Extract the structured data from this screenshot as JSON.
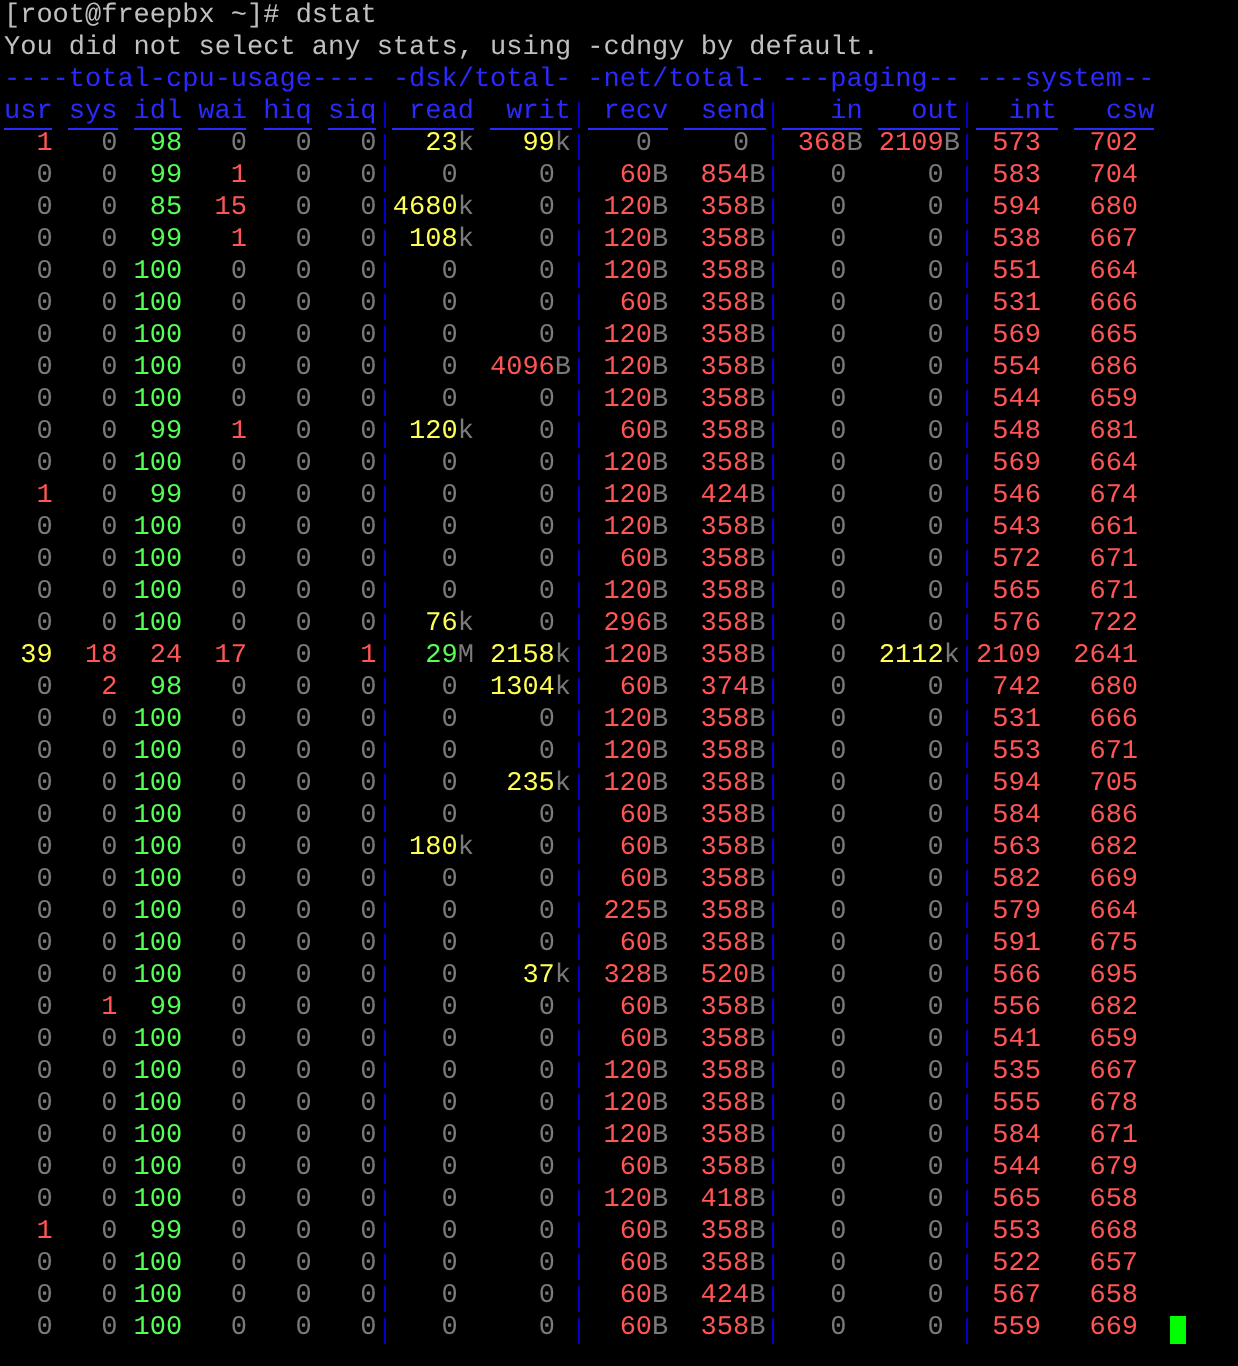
{
  "prompt": "[root@freepbx ~]# dstat",
  "message": "You did not select any stats, using -cdngy by default.",
  "groups": [
    {
      "title": "----total-cpu-usage----",
      "kind": "percent",
      "columns": [
        "usr",
        "sys",
        "idl",
        "wai",
        "hiq",
        "siq"
      ]
    },
    {
      "title": "-dsk/total-",
      "kind": "value",
      "columns": [
        "read",
        "writ"
      ]
    },
    {
      "title": "-net/total-",
      "kind": "value",
      "columns": [
        "recv",
        "send"
      ]
    },
    {
      "title": "---paging--",
      "kind": "value",
      "columns": [
        "in",
        "out"
      ]
    },
    {
      "title": "---system--",
      "kind": "value",
      "columns": [
        "int",
        "csw"
      ]
    }
  ],
  "cursor_visible": true,
  "rows": [
    {
      "cells": [
        {
          "text": "1",
          "color": "#ff5555"
        },
        {
          "text": "0"
        },
        {
          "text": "98",
          "color": "#55ff55"
        },
        {
          "text": "0"
        },
        {
          "text": "0"
        },
        {
          "text": "0"
        },
        {
          "text": "23",
          "unit": "k",
          "color": "#ffff55"
        },
        {
          "text": "99",
          "unit": "k",
          "color": "#ffff55"
        },
        {
          "text": "0"
        },
        {
          "text": "0"
        },
        {
          "text": "368",
          "unit": "B",
          "color": "#ff5555"
        },
        {
          "text": "2109",
          "unit": "B",
          "color": "#ff5555"
        },
        {
          "text": "573",
          "color": "#ff5555"
        },
        {
          "text": "702",
          "color": "#ff5555"
        }
      ]
    },
    {
      "cells": [
        {
          "text": "0"
        },
        {
          "text": "0"
        },
        {
          "text": "99",
          "color": "#55ff55"
        },
        {
          "text": "1",
          "color": "#ff5555"
        },
        {
          "text": "0"
        },
        {
          "text": "0"
        },
        {
          "text": "0"
        },
        {
          "text": "0"
        },
        {
          "text": "60",
          "unit": "B",
          "color": "#ff5555"
        },
        {
          "text": "854",
          "unit": "B",
          "color": "#ff5555"
        },
        {
          "text": "0"
        },
        {
          "text": "0"
        },
        {
          "text": "583",
          "color": "#ff5555"
        },
        {
          "text": "704",
          "color": "#ff5555"
        }
      ]
    },
    {
      "cells": [
        {
          "text": "0"
        },
        {
          "text": "0"
        },
        {
          "text": "85",
          "color": "#55ff55"
        },
        {
          "text": "15",
          "color": "#ff5555"
        },
        {
          "text": "0"
        },
        {
          "text": "0"
        },
        {
          "text": "4680",
          "unit": "k",
          "color": "#ffff55"
        },
        {
          "text": "0"
        },
        {
          "text": "120",
          "unit": "B",
          "color": "#ff5555"
        },
        {
          "text": "358",
          "unit": "B",
          "color": "#ff5555"
        },
        {
          "text": "0"
        },
        {
          "text": "0"
        },
        {
          "text": "594",
          "color": "#ff5555"
        },
        {
          "text": "680",
          "color": "#ff5555"
        }
      ]
    },
    {
      "cells": [
        {
          "text": "0"
        },
        {
          "text": "0"
        },
        {
          "text": "99",
          "color": "#55ff55"
        },
        {
          "text": "1",
          "color": "#ff5555"
        },
        {
          "text": "0"
        },
        {
          "text": "0"
        },
        {
          "text": "108",
          "unit": "k",
          "color": "#ffff55"
        },
        {
          "text": "0"
        },
        {
          "text": "120",
          "unit": "B",
          "color": "#ff5555"
        },
        {
          "text": "358",
          "unit": "B",
          "color": "#ff5555"
        },
        {
          "text": "0"
        },
        {
          "text": "0"
        },
        {
          "text": "538",
          "color": "#ff5555"
        },
        {
          "text": "667",
          "color": "#ff5555"
        }
      ]
    },
    {
      "cells": [
        {
          "text": "0"
        },
        {
          "text": "0"
        },
        {
          "text": "100",
          "color": "#55ff55"
        },
        {
          "text": "0"
        },
        {
          "text": "0"
        },
        {
          "text": "0"
        },
        {
          "text": "0"
        },
        {
          "text": "0"
        },
        {
          "text": "120",
          "unit": "B",
          "color": "#ff5555"
        },
        {
          "text": "358",
          "unit": "B",
          "color": "#ff5555"
        },
        {
          "text": "0"
        },
        {
          "text": "0"
        },
        {
          "text": "551",
          "color": "#ff5555"
        },
        {
          "text": "664",
          "color": "#ff5555"
        }
      ]
    },
    {
      "cells": [
        {
          "text": "0"
        },
        {
          "text": "0"
        },
        {
          "text": "100",
          "color": "#55ff55"
        },
        {
          "text": "0"
        },
        {
          "text": "0"
        },
        {
          "text": "0"
        },
        {
          "text": "0"
        },
        {
          "text": "0"
        },
        {
          "text": "60",
          "unit": "B",
          "color": "#ff5555"
        },
        {
          "text": "358",
          "unit": "B",
          "color": "#ff5555"
        },
        {
          "text": "0"
        },
        {
          "text": "0"
        },
        {
          "text": "531",
          "color": "#ff5555"
        },
        {
          "text": "666",
          "color": "#ff5555"
        }
      ]
    },
    {
      "cells": [
        {
          "text": "0"
        },
        {
          "text": "0"
        },
        {
          "text": "100",
          "color": "#55ff55"
        },
        {
          "text": "0"
        },
        {
          "text": "0"
        },
        {
          "text": "0"
        },
        {
          "text": "0"
        },
        {
          "text": "0"
        },
        {
          "text": "120",
          "unit": "B",
          "color": "#ff5555"
        },
        {
          "text": "358",
          "unit": "B",
          "color": "#ff5555"
        },
        {
          "text": "0"
        },
        {
          "text": "0"
        },
        {
          "text": "569",
          "color": "#ff5555"
        },
        {
          "text": "665",
          "color": "#ff5555"
        }
      ]
    },
    {
      "cells": [
        {
          "text": "0"
        },
        {
          "text": "0"
        },
        {
          "text": "100",
          "color": "#55ff55"
        },
        {
          "text": "0"
        },
        {
          "text": "0"
        },
        {
          "text": "0"
        },
        {
          "text": "0"
        },
        {
          "text": "4096",
          "unit": "B",
          "color": "#ff5555"
        },
        {
          "text": "120",
          "unit": "B",
          "color": "#ff5555"
        },
        {
          "text": "358",
          "unit": "B",
          "color": "#ff5555"
        },
        {
          "text": "0"
        },
        {
          "text": "0"
        },
        {
          "text": "554",
          "color": "#ff5555"
        },
        {
          "text": "686",
          "color": "#ff5555"
        }
      ]
    },
    {
      "cells": [
        {
          "text": "0"
        },
        {
          "text": "0"
        },
        {
          "text": "100",
          "color": "#55ff55"
        },
        {
          "text": "0"
        },
        {
          "text": "0"
        },
        {
          "text": "0"
        },
        {
          "text": "0"
        },
        {
          "text": "0"
        },
        {
          "text": "120",
          "unit": "B",
          "color": "#ff5555"
        },
        {
          "text": "358",
          "unit": "B",
          "color": "#ff5555"
        },
        {
          "text": "0"
        },
        {
          "text": "0"
        },
        {
          "text": "544",
          "color": "#ff5555"
        },
        {
          "text": "659",
          "color": "#ff5555"
        }
      ]
    },
    {
      "cells": [
        {
          "text": "0"
        },
        {
          "text": "0"
        },
        {
          "text": "99",
          "color": "#55ff55"
        },
        {
          "text": "1",
          "color": "#ff5555"
        },
        {
          "text": "0"
        },
        {
          "text": "0"
        },
        {
          "text": "120",
          "unit": "k",
          "color": "#ffff55"
        },
        {
          "text": "0"
        },
        {
          "text": "60",
          "unit": "B",
          "color": "#ff5555"
        },
        {
          "text": "358",
          "unit": "B",
          "color": "#ff5555"
        },
        {
          "text": "0"
        },
        {
          "text": "0"
        },
        {
          "text": "548",
          "color": "#ff5555"
        },
        {
          "text": "681",
          "color": "#ff5555"
        }
      ]
    },
    {
      "cells": [
        {
          "text": "0"
        },
        {
          "text": "0"
        },
        {
          "text": "100",
          "color": "#55ff55"
        },
        {
          "text": "0"
        },
        {
          "text": "0"
        },
        {
          "text": "0"
        },
        {
          "text": "0"
        },
        {
          "text": "0"
        },
        {
          "text": "120",
          "unit": "B",
          "color": "#ff5555"
        },
        {
          "text": "358",
          "unit": "B",
          "color": "#ff5555"
        },
        {
          "text": "0"
        },
        {
          "text": "0"
        },
        {
          "text": "569",
          "color": "#ff5555"
        },
        {
          "text": "664",
          "color": "#ff5555"
        }
      ]
    },
    {
      "cells": [
        {
          "text": "1",
          "color": "#ff5555"
        },
        {
          "text": "0"
        },
        {
          "text": "99",
          "color": "#55ff55"
        },
        {
          "text": "0"
        },
        {
          "text": "0"
        },
        {
          "text": "0"
        },
        {
          "text": "0"
        },
        {
          "text": "0"
        },
        {
          "text": "120",
          "unit": "B",
          "color": "#ff5555"
        },
        {
          "text": "424",
          "unit": "B",
          "color": "#ff5555"
        },
        {
          "text": "0"
        },
        {
          "text": "0"
        },
        {
          "text": "546",
          "color": "#ff5555"
        },
        {
          "text": "674",
          "color": "#ff5555"
        }
      ]
    },
    {
      "cells": [
        {
          "text": "0"
        },
        {
          "text": "0"
        },
        {
          "text": "100",
          "color": "#55ff55"
        },
        {
          "text": "0"
        },
        {
          "text": "0"
        },
        {
          "text": "0"
        },
        {
          "text": "0"
        },
        {
          "text": "0"
        },
        {
          "text": "120",
          "unit": "B",
          "color": "#ff5555"
        },
        {
          "text": "358",
          "unit": "B",
          "color": "#ff5555"
        },
        {
          "text": "0"
        },
        {
          "text": "0"
        },
        {
          "text": "543",
          "color": "#ff5555"
        },
        {
          "text": "661",
          "color": "#ff5555"
        }
      ]
    },
    {
      "cells": [
        {
          "text": "0"
        },
        {
          "text": "0"
        },
        {
          "text": "100",
          "color": "#55ff55"
        },
        {
          "text": "0"
        },
        {
          "text": "0"
        },
        {
          "text": "0"
        },
        {
          "text": "0"
        },
        {
          "text": "0"
        },
        {
          "text": "60",
          "unit": "B",
          "color": "#ff5555"
        },
        {
          "text": "358",
          "unit": "B",
          "color": "#ff5555"
        },
        {
          "text": "0"
        },
        {
          "text": "0"
        },
        {
          "text": "572",
          "color": "#ff5555"
        },
        {
          "text": "671",
          "color": "#ff5555"
        }
      ]
    },
    {
      "cells": [
        {
          "text": "0"
        },
        {
          "text": "0"
        },
        {
          "text": "100",
          "color": "#55ff55"
        },
        {
          "text": "0"
        },
        {
          "text": "0"
        },
        {
          "text": "0"
        },
        {
          "text": "0"
        },
        {
          "text": "0"
        },
        {
          "text": "120",
          "unit": "B",
          "color": "#ff5555"
        },
        {
          "text": "358",
          "unit": "B",
          "color": "#ff5555"
        },
        {
          "text": "0"
        },
        {
          "text": "0"
        },
        {
          "text": "565",
          "color": "#ff5555"
        },
        {
          "text": "671",
          "color": "#ff5555"
        }
      ]
    },
    {
      "cells": [
        {
          "text": "0"
        },
        {
          "text": "0"
        },
        {
          "text": "100",
          "color": "#55ff55"
        },
        {
          "text": "0"
        },
        {
          "text": "0"
        },
        {
          "text": "0"
        },
        {
          "text": "76",
          "unit": "k",
          "color": "#ffff55"
        },
        {
          "text": "0"
        },
        {
          "text": "296",
          "unit": "B",
          "color": "#ff5555"
        },
        {
          "text": "358",
          "unit": "B",
          "color": "#ff5555"
        },
        {
          "text": "0"
        },
        {
          "text": "0"
        },
        {
          "text": "576",
          "color": "#ff5555"
        },
        {
          "text": "722",
          "color": "#ff5555"
        }
      ]
    },
    {
      "cells": [
        {
          "text": "39",
          "color": "#ffff55"
        },
        {
          "text": "18",
          "color": "#ff5555"
        },
        {
          "text": "24",
          "color": "#ff5555"
        },
        {
          "text": "17",
          "color": "#ff5555"
        },
        {
          "text": "0"
        },
        {
          "text": "1",
          "color": "#ff5555"
        },
        {
          "text": "29",
          "unit": "M",
          "color": "#55ff55"
        },
        {
          "text": "2158",
          "unit": "k",
          "color": "#ffff55"
        },
        {
          "text": "120",
          "unit": "B",
          "color": "#ff5555"
        },
        {
          "text": "358",
          "unit": "B",
          "color": "#ff5555"
        },
        {
          "text": "0"
        },
        {
          "text": "2112",
          "unit": "k",
          "color": "#ffff55"
        },
        {
          "text": "2109",
          "color": "#ff5555"
        },
        {
          "text": "2641",
          "color": "#ff5555"
        }
      ]
    },
    {
      "cells": [
        {
          "text": "0"
        },
        {
          "text": "2",
          "color": "#ff5555"
        },
        {
          "text": "98",
          "color": "#55ff55"
        },
        {
          "text": "0"
        },
        {
          "text": "0"
        },
        {
          "text": "0"
        },
        {
          "text": "0"
        },
        {
          "text": "1304",
          "unit": "k",
          "color": "#ffff55"
        },
        {
          "text": "60",
          "unit": "B",
          "color": "#ff5555"
        },
        {
          "text": "374",
          "unit": "B",
          "color": "#ff5555"
        },
        {
          "text": "0"
        },
        {
          "text": "0"
        },
        {
          "text": "742",
          "color": "#ff5555"
        },
        {
          "text": "680",
          "color": "#ff5555"
        }
      ]
    },
    {
      "cells": [
        {
          "text": "0"
        },
        {
          "text": "0"
        },
        {
          "text": "100",
          "color": "#55ff55"
        },
        {
          "text": "0"
        },
        {
          "text": "0"
        },
        {
          "text": "0"
        },
        {
          "text": "0"
        },
        {
          "text": "0"
        },
        {
          "text": "120",
          "unit": "B",
          "color": "#ff5555"
        },
        {
          "text": "358",
          "unit": "B",
          "color": "#ff5555"
        },
        {
          "text": "0"
        },
        {
          "text": "0"
        },
        {
          "text": "531",
          "color": "#ff5555"
        },
        {
          "text": "666",
          "color": "#ff5555"
        }
      ]
    },
    {
      "cells": [
        {
          "text": "0"
        },
        {
          "text": "0"
        },
        {
          "text": "100",
          "color": "#55ff55"
        },
        {
          "text": "0"
        },
        {
          "text": "0"
        },
        {
          "text": "0"
        },
        {
          "text": "0"
        },
        {
          "text": "0"
        },
        {
          "text": "120",
          "unit": "B",
          "color": "#ff5555"
        },
        {
          "text": "358",
          "unit": "B",
          "color": "#ff5555"
        },
        {
          "text": "0"
        },
        {
          "text": "0"
        },
        {
          "text": "553",
          "color": "#ff5555"
        },
        {
          "text": "671",
          "color": "#ff5555"
        }
      ]
    },
    {
      "cells": [
        {
          "text": "0"
        },
        {
          "text": "0"
        },
        {
          "text": "100",
          "color": "#55ff55"
        },
        {
          "text": "0"
        },
        {
          "text": "0"
        },
        {
          "text": "0"
        },
        {
          "text": "0"
        },
        {
          "text": "235",
          "unit": "k",
          "color": "#ffff55"
        },
        {
          "text": "120",
          "unit": "B",
          "color": "#ff5555"
        },
        {
          "text": "358",
          "unit": "B",
          "color": "#ff5555"
        },
        {
          "text": "0"
        },
        {
          "text": "0"
        },
        {
          "text": "594",
          "color": "#ff5555"
        },
        {
          "text": "705",
          "color": "#ff5555"
        }
      ]
    },
    {
      "cells": [
        {
          "text": "0"
        },
        {
          "text": "0"
        },
        {
          "text": "100",
          "color": "#55ff55"
        },
        {
          "text": "0"
        },
        {
          "text": "0"
        },
        {
          "text": "0"
        },
        {
          "text": "0"
        },
        {
          "text": "0"
        },
        {
          "text": "60",
          "unit": "B",
          "color": "#ff5555"
        },
        {
          "text": "358",
          "unit": "B",
          "color": "#ff5555"
        },
        {
          "text": "0"
        },
        {
          "text": "0"
        },
        {
          "text": "584",
          "color": "#ff5555"
        },
        {
          "text": "686",
          "color": "#ff5555"
        }
      ]
    },
    {
      "cells": [
        {
          "text": "0"
        },
        {
          "text": "0"
        },
        {
          "text": "100",
          "color": "#55ff55"
        },
        {
          "text": "0"
        },
        {
          "text": "0"
        },
        {
          "text": "0"
        },
        {
          "text": "180",
          "unit": "k",
          "color": "#ffff55"
        },
        {
          "text": "0"
        },
        {
          "text": "60",
          "unit": "B",
          "color": "#ff5555"
        },
        {
          "text": "358",
          "unit": "B",
          "color": "#ff5555"
        },
        {
          "text": "0"
        },
        {
          "text": "0"
        },
        {
          "text": "563",
          "color": "#ff5555"
        },
        {
          "text": "682",
          "color": "#ff5555"
        }
      ]
    },
    {
      "cells": [
        {
          "text": "0"
        },
        {
          "text": "0"
        },
        {
          "text": "100",
          "color": "#55ff55"
        },
        {
          "text": "0"
        },
        {
          "text": "0"
        },
        {
          "text": "0"
        },
        {
          "text": "0"
        },
        {
          "text": "0"
        },
        {
          "text": "60",
          "unit": "B",
          "color": "#ff5555"
        },
        {
          "text": "358",
          "unit": "B",
          "color": "#ff5555"
        },
        {
          "text": "0"
        },
        {
          "text": "0"
        },
        {
          "text": "582",
          "color": "#ff5555"
        },
        {
          "text": "669",
          "color": "#ff5555"
        }
      ]
    },
    {
      "cells": [
        {
          "text": "0"
        },
        {
          "text": "0"
        },
        {
          "text": "100",
          "color": "#55ff55"
        },
        {
          "text": "0"
        },
        {
          "text": "0"
        },
        {
          "text": "0"
        },
        {
          "text": "0"
        },
        {
          "text": "0"
        },
        {
          "text": "225",
          "unit": "B",
          "color": "#ff5555"
        },
        {
          "text": "358",
          "unit": "B",
          "color": "#ff5555"
        },
        {
          "text": "0"
        },
        {
          "text": "0"
        },
        {
          "text": "579",
          "color": "#ff5555"
        },
        {
          "text": "664",
          "color": "#ff5555"
        }
      ]
    },
    {
      "cells": [
        {
          "text": "0"
        },
        {
          "text": "0"
        },
        {
          "text": "100",
          "color": "#55ff55"
        },
        {
          "text": "0"
        },
        {
          "text": "0"
        },
        {
          "text": "0"
        },
        {
          "text": "0"
        },
        {
          "text": "0"
        },
        {
          "text": "60",
          "unit": "B",
          "color": "#ff5555"
        },
        {
          "text": "358",
          "unit": "B",
          "color": "#ff5555"
        },
        {
          "text": "0"
        },
        {
          "text": "0"
        },
        {
          "text": "591",
          "color": "#ff5555"
        },
        {
          "text": "675",
          "color": "#ff5555"
        }
      ]
    },
    {
      "cells": [
        {
          "text": "0"
        },
        {
          "text": "0"
        },
        {
          "text": "100",
          "color": "#55ff55"
        },
        {
          "text": "0"
        },
        {
          "text": "0"
        },
        {
          "text": "0"
        },
        {
          "text": "0"
        },
        {
          "text": "37",
          "unit": "k",
          "color": "#ffff55"
        },
        {
          "text": "328",
          "unit": "B",
          "color": "#ff5555"
        },
        {
          "text": "520",
          "unit": "B",
          "color": "#ff5555"
        },
        {
          "text": "0"
        },
        {
          "text": "0"
        },
        {
          "text": "566",
          "color": "#ff5555"
        },
        {
          "text": "695",
          "color": "#ff5555"
        }
      ]
    },
    {
      "cells": [
        {
          "text": "0"
        },
        {
          "text": "1",
          "color": "#ff5555"
        },
        {
          "text": "99",
          "color": "#55ff55"
        },
        {
          "text": "0"
        },
        {
          "text": "0"
        },
        {
          "text": "0"
        },
        {
          "text": "0"
        },
        {
          "text": "0"
        },
        {
          "text": "60",
          "unit": "B",
          "color": "#ff5555"
        },
        {
          "text": "358",
          "unit": "B",
          "color": "#ff5555"
        },
        {
          "text": "0"
        },
        {
          "text": "0"
        },
        {
          "text": "556",
          "color": "#ff5555"
        },
        {
          "text": "682",
          "color": "#ff5555"
        }
      ]
    },
    {
      "cells": [
        {
          "text": "0"
        },
        {
          "text": "0"
        },
        {
          "text": "100",
          "color": "#55ff55"
        },
        {
          "text": "0"
        },
        {
          "text": "0"
        },
        {
          "text": "0"
        },
        {
          "text": "0"
        },
        {
          "text": "0"
        },
        {
          "text": "60",
          "unit": "B",
          "color": "#ff5555"
        },
        {
          "text": "358",
          "unit": "B",
          "color": "#ff5555"
        },
        {
          "text": "0"
        },
        {
          "text": "0"
        },
        {
          "text": "541",
          "color": "#ff5555"
        },
        {
          "text": "659",
          "color": "#ff5555"
        }
      ]
    },
    {
      "cells": [
        {
          "text": "0"
        },
        {
          "text": "0"
        },
        {
          "text": "100",
          "color": "#55ff55"
        },
        {
          "text": "0"
        },
        {
          "text": "0"
        },
        {
          "text": "0"
        },
        {
          "text": "0"
        },
        {
          "text": "0"
        },
        {
          "text": "120",
          "unit": "B",
          "color": "#ff5555"
        },
        {
          "text": "358",
          "unit": "B",
          "color": "#ff5555"
        },
        {
          "text": "0"
        },
        {
          "text": "0"
        },
        {
          "text": "535",
          "color": "#ff5555"
        },
        {
          "text": "667",
          "color": "#ff5555"
        }
      ]
    },
    {
      "cells": [
        {
          "text": "0"
        },
        {
          "text": "0"
        },
        {
          "text": "100",
          "color": "#55ff55"
        },
        {
          "text": "0"
        },
        {
          "text": "0"
        },
        {
          "text": "0"
        },
        {
          "text": "0"
        },
        {
          "text": "0"
        },
        {
          "text": "120",
          "unit": "B",
          "color": "#ff5555"
        },
        {
          "text": "358",
          "unit": "B",
          "color": "#ff5555"
        },
        {
          "text": "0"
        },
        {
          "text": "0"
        },
        {
          "text": "555",
          "color": "#ff5555"
        },
        {
          "text": "678",
          "color": "#ff5555"
        }
      ]
    },
    {
      "cells": [
        {
          "text": "0"
        },
        {
          "text": "0"
        },
        {
          "text": "100",
          "color": "#55ff55"
        },
        {
          "text": "0"
        },
        {
          "text": "0"
        },
        {
          "text": "0"
        },
        {
          "text": "0"
        },
        {
          "text": "0"
        },
        {
          "text": "120",
          "unit": "B",
          "color": "#ff5555"
        },
        {
          "text": "358",
          "unit": "B",
          "color": "#ff5555"
        },
        {
          "text": "0"
        },
        {
          "text": "0"
        },
        {
          "text": "584",
          "color": "#ff5555"
        },
        {
          "text": "671",
          "color": "#ff5555"
        }
      ]
    },
    {
      "cells": [
        {
          "text": "0"
        },
        {
          "text": "0"
        },
        {
          "text": "100",
          "color": "#55ff55"
        },
        {
          "text": "0"
        },
        {
          "text": "0"
        },
        {
          "text": "0"
        },
        {
          "text": "0"
        },
        {
          "text": "0"
        },
        {
          "text": "60",
          "unit": "B",
          "color": "#ff5555"
        },
        {
          "text": "358",
          "unit": "B",
          "color": "#ff5555"
        },
        {
          "text": "0"
        },
        {
          "text": "0"
        },
        {
          "text": "544",
          "color": "#ff5555"
        },
        {
          "text": "679",
          "color": "#ff5555"
        }
      ]
    },
    {
      "cells": [
        {
          "text": "0"
        },
        {
          "text": "0"
        },
        {
          "text": "100",
          "color": "#55ff55"
        },
        {
          "text": "0"
        },
        {
          "text": "0"
        },
        {
          "text": "0"
        },
        {
          "text": "0"
        },
        {
          "text": "0"
        },
        {
          "text": "120",
          "unit": "B",
          "color": "#ff5555"
        },
        {
          "text": "418",
          "unit": "B",
          "color": "#ff5555"
        },
        {
          "text": "0"
        },
        {
          "text": "0"
        },
        {
          "text": "565",
          "color": "#ff5555"
        },
        {
          "text": "658",
          "color": "#ff5555"
        }
      ]
    },
    {
      "cells": [
        {
          "text": "1",
          "color": "#ff5555"
        },
        {
          "text": "0"
        },
        {
          "text": "99",
          "color": "#55ff55"
        },
        {
          "text": "0"
        },
        {
          "text": "0"
        },
        {
          "text": "0"
        },
        {
          "text": "0"
        },
        {
          "text": "0"
        },
        {
          "text": "60",
          "unit": "B",
          "color": "#ff5555"
        },
        {
          "text": "358",
          "unit": "B",
          "color": "#ff5555"
        },
        {
          "text": "0"
        },
        {
          "text": "0"
        },
        {
          "text": "553",
          "color": "#ff5555"
        },
        {
          "text": "668",
          "color": "#ff5555"
        }
      ]
    },
    {
      "cells": [
        {
          "text": "0"
        },
        {
          "text": "0"
        },
        {
          "text": "100",
          "color": "#55ff55"
        },
        {
          "text": "0"
        },
        {
          "text": "0"
        },
        {
          "text": "0"
        },
        {
          "text": "0"
        },
        {
          "text": "0"
        },
        {
          "text": "60",
          "unit": "B",
          "color": "#ff5555"
        },
        {
          "text": "358",
          "unit": "B",
          "color": "#ff5555"
        },
        {
          "text": "0"
        },
        {
          "text": "0"
        },
        {
          "text": "522",
          "color": "#ff5555"
        },
        {
          "text": "657",
          "color": "#ff5555"
        }
      ]
    },
    {
      "cells": [
        {
          "text": "0"
        },
        {
          "text": "0"
        },
        {
          "text": "100",
          "color": "#55ff55"
        },
        {
          "text": "0"
        },
        {
          "text": "0"
        },
        {
          "text": "0"
        },
        {
          "text": "0"
        },
        {
          "text": "0"
        },
        {
          "text": "60",
          "unit": "B",
          "color": "#ff5555"
        },
        {
          "text": "424",
          "unit": "B",
          "color": "#ff5555"
        },
        {
          "text": "0"
        },
        {
          "text": "0"
        },
        {
          "text": "567",
          "color": "#ff5555"
        },
        {
          "text": "658",
          "color": "#ff5555"
        }
      ]
    },
    {
      "cells": [
        {
          "text": "0"
        },
        {
          "text": "0"
        },
        {
          "text": "100",
          "color": "#55ff55"
        },
        {
          "text": "0"
        },
        {
          "text": "0"
        },
        {
          "text": "0"
        },
        {
          "text": "0"
        },
        {
          "text": "0"
        },
        {
          "text": "60",
          "unit": "B",
          "color": "#ff5555"
        },
        {
          "text": "358",
          "unit": "B",
          "color": "#ff5555"
        },
        {
          "text": "0"
        },
        {
          "text": "0"
        },
        {
          "text": "559",
          "color": "#ff5555"
        },
        {
          "text": "669",
          "color": "#ff5555"
        }
      ]
    }
  ]
}
